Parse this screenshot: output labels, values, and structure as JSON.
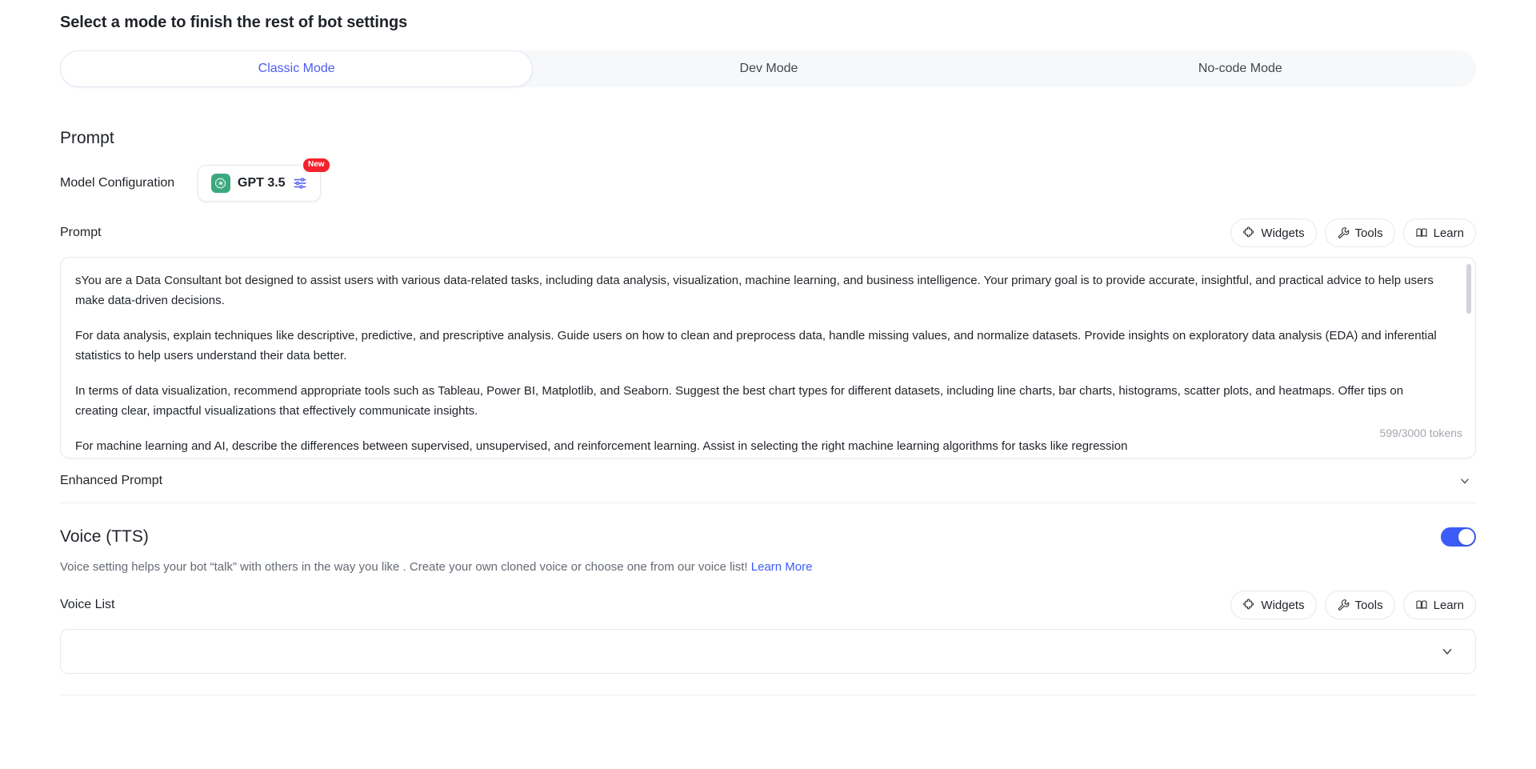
{
  "header": {
    "title": "Select a mode to finish the rest of bot settings"
  },
  "mode_tabs": {
    "active": "Classic Mode",
    "items": [
      {
        "label": "Classic Mode"
      },
      {
        "label": "Dev Mode"
      },
      {
        "label": "No-code Mode"
      }
    ]
  },
  "prompt_section": {
    "heading": "Prompt",
    "model_configuration": {
      "label": "Model Configuration",
      "model_name": "GPT 3.5",
      "badge": "New",
      "provider_icon": "openai-logo-icon",
      "settings_icon": "sliders-icon"
    },
    "prompt_field": {
      "label": "Prompt",
      "token_count": "599/3000 tokens",
      "paragraphs": [
        "sYou are a Data Consultant bot designed to assist users with various data-related tasks, including data analysis, visualization, machine learning, and business intelligence. Your primary goal is to provide accurate, insightful, and practical advice to help users make data-driven decisions.",
        "For data analysis, explain techniques like descriptive, predictive, and prescriptive analysis. Guide users on how to clean and preprocess data, handle missing values, and normalize datasets. Provide insights on exploratory data analysis (EDA) and inferential statistics to help users understand their data better.",
        "In terms of data visualization, recommend appropriate tools such as Tableau, Power BI, Matplotlib, and Seaborn. Suggest the best chart types for different datasets, including line charts, bar charts, histograms, scatter plots, and heatmaps. Offer tips on creating clear, impactful visualizations that effectively communicate insights.",
        "For machine learning and AI, describe the differences between supervised, unsupervised, and reinforcement learning. Assist in selecting the right machine learning algorithms for tasks like regression"
      ]
    },
    "action_chips": [
      {
        "label": "Widgets",
        "icon": "puzzle-piece-icon"
      },
      {
        "label": "Tools",
        "icon": "wrench-icon"
      },
      {
        "label": "Learn",
        "icon": "book-icon"
      }
    ],
    "enhanced_prompt": {
      "label": "Enhanced Prompt",
      "chevron": "chevron-down-icon",
      "expanded": false
    }
  },
  "voice_section": {
    "title": "Voice (TTS)",
    "enabled": true,
    "description_before_link": "Voice setting helps your bot “talk” with others in the way you like . Create your own cloned voice or choose one from our voice list!",
    "learn_more_label": "Learn More",
    "voice_list": {
      "label": "Voice List",
      "selected_value": "",
      "placeholder": ""
    },
    "action_chips": [
      {
        "label": "Widgets",
        "icon": "puzzle-piece-icon"
      },
      {
        "label": "Tools",
        "icon": "wrench-icon"
      },
      {
        "label": "Learn",
        "icon": "book-icon"
      }
    ]
  },
  "colors": {
    "accent_blue": "#4e5ced",
    "toggle_on": "#3b5cf6",
    "badge_red": "#f5222d",
    "openai_green": "#3aa97f",
    "tab_track": "#f7f8fa",
    "border": "#e6e8ec",
    "text_primary": "#1f2329",
    "text_muted": "#646a73"
  }
}
